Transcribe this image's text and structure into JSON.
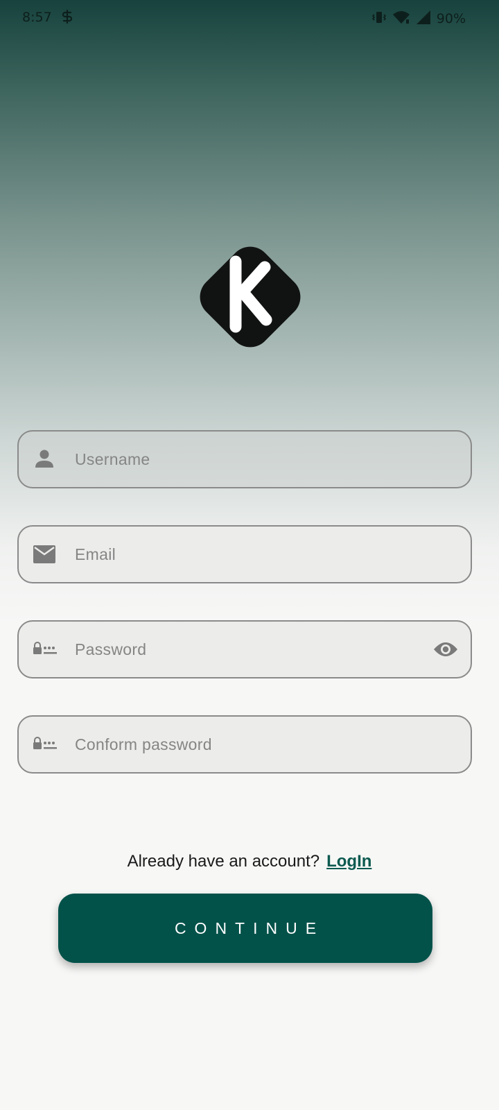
{
  "status_bar": {
    "time": "8:57",
    "battery_percent": "90%",
    "app_icon": "s-app-icon",
    "icons": [
      "vibrate-icon",
      "wifi-icon",
      "signal-icon"
    ]
  },
  "logo": {
    "letter": "K",
    "icon": "k-diamond-logo"
  },
  "form": {
    "username": {
      "placeholder": "Username",
      "icon": "person-icon"
    },
    "email": {
      "placeholder": "Email",
      "icon": "mail-icon"
    },
    "password": {
      "placeholder": "Password",
      "icon": "password-icon",
      "toggle_icon": "eye-icon"
    },
    "confirm_password": {
      "placeholder": "Conform password",
      "icon": "password-icon"
    }
  },
  "account_prompt": {
    "text": "Already have an account?",
    "link": "LogIn"
  },
  "continue_button": {
    "label": "CONTINUE"
  },
  "colors": {
    "accent": "#02524a",
    "link": "#0d5a50",
    "gradient_top": "#17423d",
    "background": "#f7f7f6"
  }
}
